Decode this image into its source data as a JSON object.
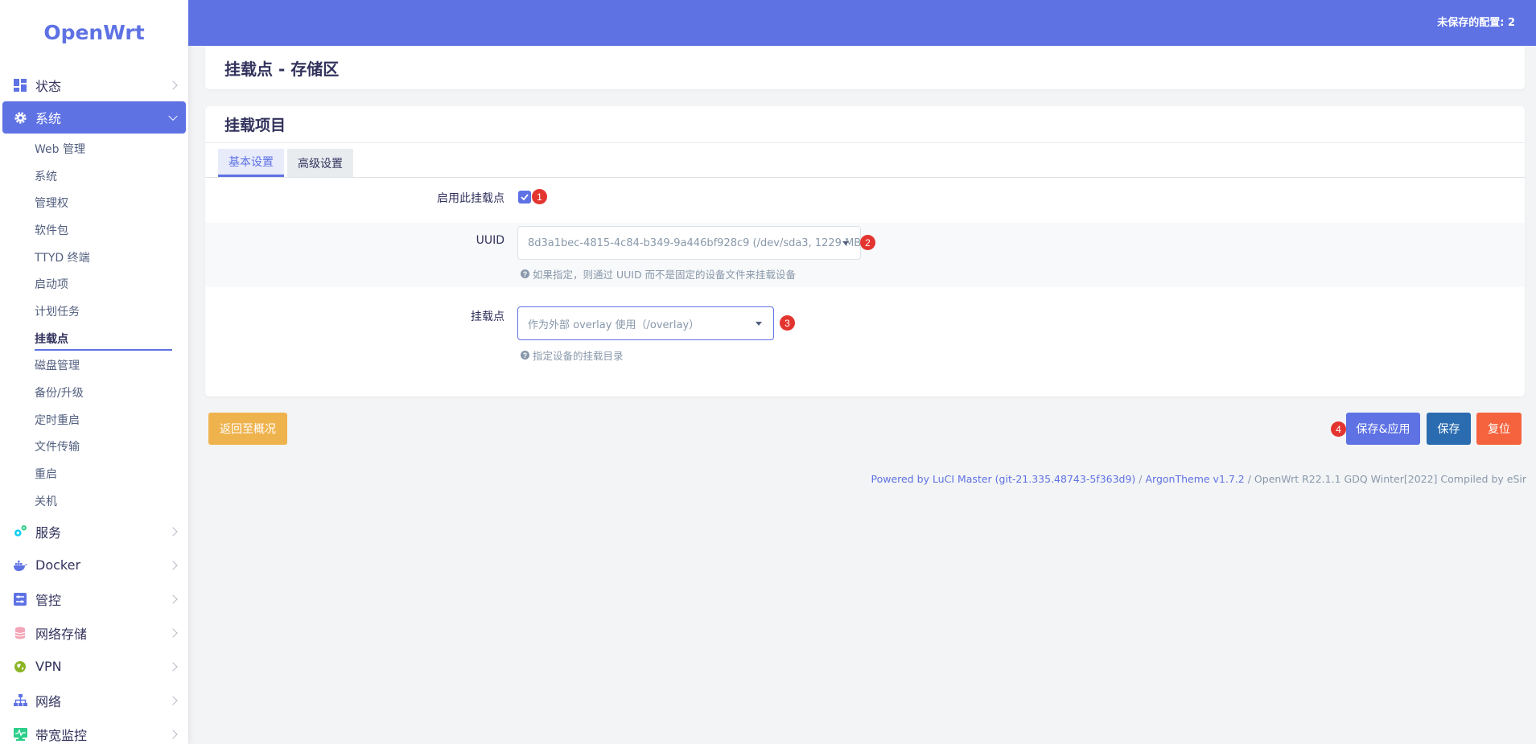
{
  "app": {
    "logo": "OpenWrt",
    "unsaved": "未保存的配置: 2"
  },
  "sidebar": {
    "top_items": [
      {
        "label": "状态",
        "icon": "dashboard-icon"
      },
      {
        "label": "系统",
        "icon": "gear-icon"
      }
    ],
    "sub_items": [
      "Web 管理",
      "系统",
      "管理权",
      "软件包",
      "TTYD 终端",
      "启动项",
      "计划任务",
      "挂载点",
      "磁盘管理",
      "备份/升级",
      "定时重启",
      "文件传输",
      "重启",
      "关机"
    ],
    "bottom_items": [
      {
        "label": "服务",
        "icon": "services-icon"
      },
      {
        "label": "Docker",
        "icon": "docker-icon"
      },
      {
        "label": "管控",
        "icon": "control-icon"
      },
      {
        "label": "网络存储",
        "icon": "storage-icon"
      },
      {
        "label": "VPN",
        "icon": "vpn-icon"
      },
      {
        "label": "网络",
        "icon": "network-icon"
      },
      {
        "label": "带宽监控",
        "icon": "monitor-icon"
      }
    ]
  },
  "page": {
    "title": "挂载点 - 存储区"
  },
  "section": {
    "title": "挂载项目",
    "tabs": [
      "基本设置",
      "高级设置"
    ],
    "enable": {
      "label": "启用此挂载点",
      "checked": true,
      "badge": "1"
    },
    "uuid": {
      "label": "UUID",
      "value": "8d3a1bec-4815-4c84-b349-9a446bf928c9 (/dev/sda3, 1229 MB)",
      "hint": "如果指定，则通过 UUID 而不是固定的设备文件来挂载设备",
      "badge": "2"
    },
    "mountpoint": {
      "label": "挂载点",
      "value": "作为外部 overlay 使用（/overlay）",
      "hint": "指定设备的挂载目录",
      "badge": "3"
    }
  },
  "actions": {
    "back": "返回至概况",
    "save_apply": "保存&应用",
    "save": "保存",
    "reset": "复位",
    "badge": "4"
  },
  "footer": {
    "luci": "Powered by LuCI Master (git-21.335.48743-5f363d9)",
    "sep": " / ",
    "theme": "ArgonTheme v1.7.2",
    "rest": " / OpenWrt R22.1.1 GDQ Winter[2022] Compiled by eSir"
  },
  "colors": {
    "accent": "#5e72e4",
    "warning": "#efb34e",
    "info": "#2b6cb0",
    "danger": "#f5633e",
    "badge": "#e3342f"
  }
}
